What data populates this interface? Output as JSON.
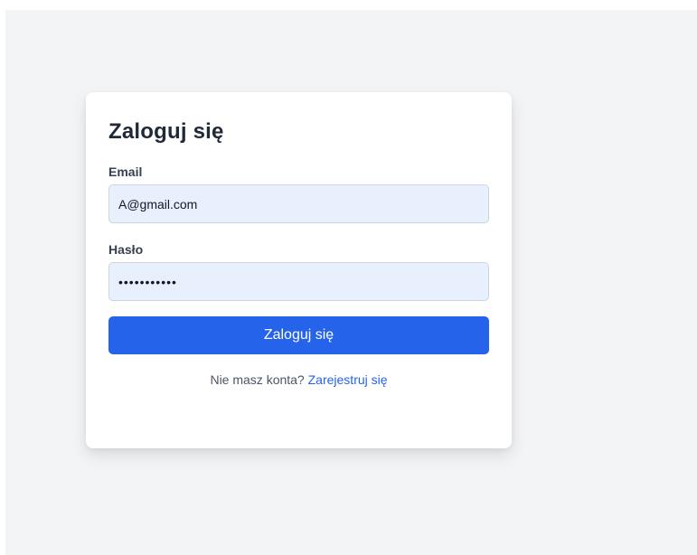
{
  "login": {
    "title": "Zaloguj się",
    "email_label": "Email",
    "email_value": "A@gmail.com",
    "password_label": "Hasło",
    "password_value": "aaaaaaaaaaa",
    "submit_label": "Zaloguj się",
    "register_prompt": "Nie masz konta?",
    "register_link": "Zarejestruj się"
  },
  "colors": {
    "page_background": "#f3f4f6",
    "card_background": "#ffffff",
    "input_background": "#e8f0fe",
    "primary": "#2563eb",
    "heading": "#1f2937"
  }
}
